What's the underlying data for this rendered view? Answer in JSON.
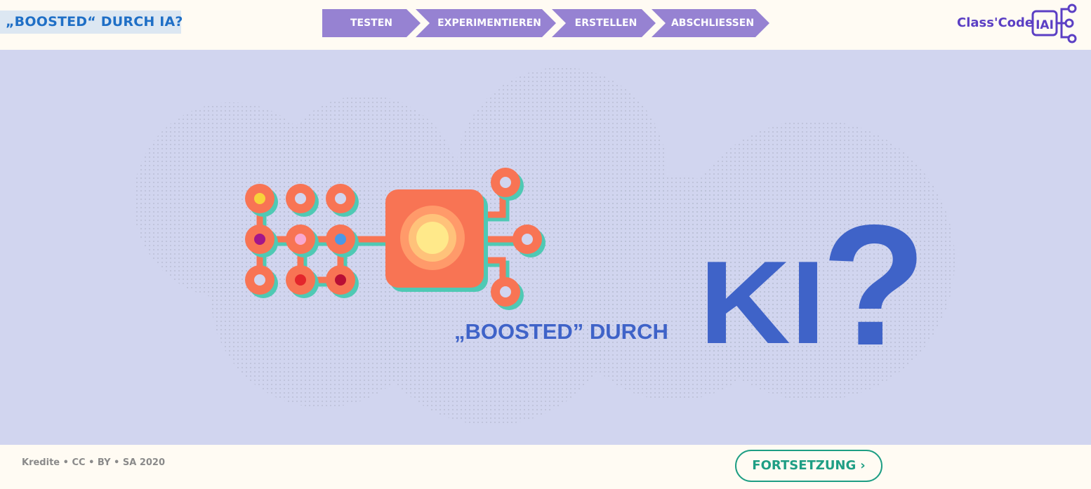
{
  "header": {
    "title": "„BOOSTED“ DURCH IA?",
    "steps": [
      {
        "label": "TESTEN"
      },
      {
        "label": "EXPERIMENTIEREN"
      },
      {
        "label": "ERSTELLEN"
      },
      {
        "label": "ABSCHLIESSEN"
      }
    ],
    "logo_text": "Class'Code",
    "logo_badge": "IAI"
  },
  "hero": {
    "caption": "„BOOSTED” DURCH",
    "big_text": "KI",
    "question_mark": "?"
  },
  "footer": {
    "credits": "Kredite • CC • BY • SA 2020",
    "continue_label": "FORTSETZUNG",
    "continue_icon": "chevron-right-icon"
  },
  "colors": {
    "step_bg": "#9682d2",
    "accent_blue": "#3f63c8",
    "circuit_orange": "#f87454",
    "circuit_teal": "#4fc9b4",
    "continue_green": "#1e9e84",
    "hero_bg": "#d1d5ef"
  }
}
